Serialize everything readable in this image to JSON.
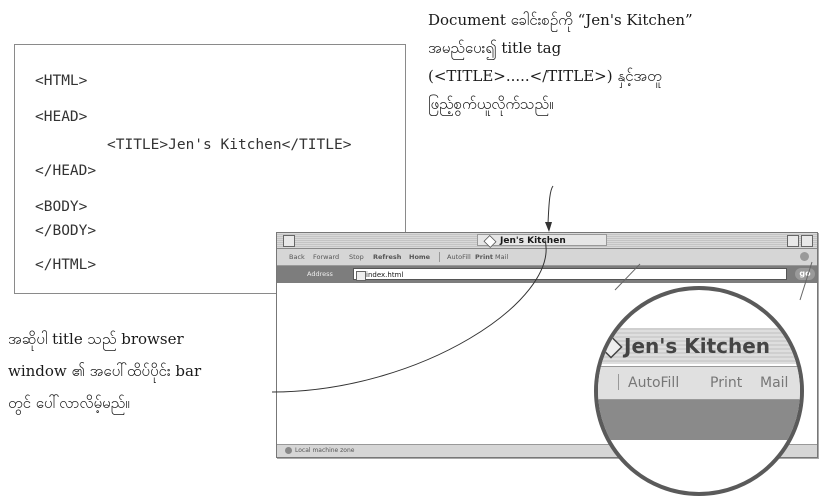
{
  "caption_top": {
    "line1": "Document ခေါင်းစဉ်ကို “Jen's Kitchen”",
    "line2": "အမည်ပေး၍ title tag",
    "line3": "(<TITLE>.....</TITLE>) နှင့်အတူ",
    "line4": "ဖြည့်စွက်ယူလိုက်သည်။"
  },
  "code": {
    "l1": "<HTML>",
    "l2": "<HEAD>",
    "l3": "<TITLE>Jen's Kitchen</TITLE>",
    "l4": "</HEAD>",
    "l5": "<BODY>",
    "l6": "</BODY>",
    "l7": "</HTML>"
  },
  "caption_left": {
    "line1": "အဆိုပါ title သည် browser",
    "line2": "window ၏ အပေါ်ထိပ်ပိုင်း bar",
    "line3": "တွင် ပေါ်လာလိမ့်မည်။"
  },
  "browser": {
    "title": "Jen's Kitchen",
    "toolbar": [
      "Back",
      "Forward",
      "Stop",
      "Refresh",
      "Home",
      "AutoFill",
      "Print",
      "Mail"
    ],
    "address_label": "Address",
    "address_value": "index.html",
    "go_label": "go",
    "status_text": "Local machine zone"
  },
  "magnifier": {
    "title": "Jen's Kitchen",
    "tools": [
      "AutoFill",
      "Print",
      "Mail"
    ]
  }
}
